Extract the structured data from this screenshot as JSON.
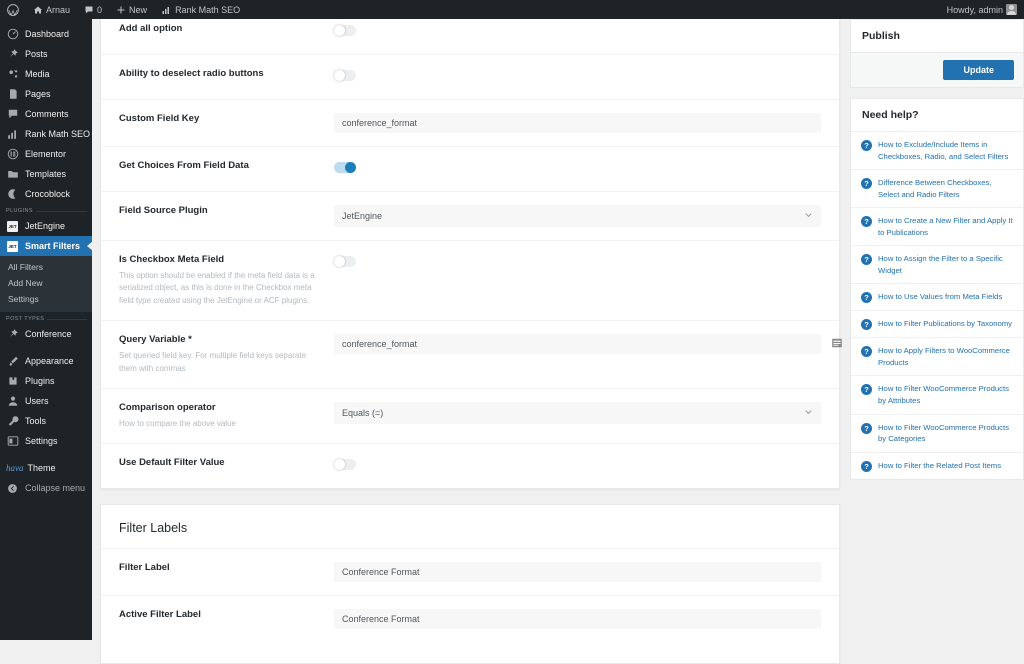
{
  "adminbar": {
    "wp_logo": "wordpress-logo",
    "site_name": "Arnau",
    "comments_count": "0",
    "new_label": "New",
    "rank_math_label": "Rank Math SEO",
    "howdy": "Howdy, admin"
  },
  "sidebar": {
    "items": [
      {
        "label": "Dashboard",
        "icon": "dashboard-icon",
        "name": "dashboard"
      },
      {
        "label": "Posts",
        "icon": "pin-icon",
        "name": "posts"
      },
      {
        "label": "Media",
        "icon": "media-icon",
        "name": "media"
      },
      {
        "label": "Pages",
        "icon": "page-icon",
        "name": "pages"
      },
      {
        "label": "Comments",
        "icon": "comment-icon",
        "name": "comments"
      },
      {
        "label": "Rank Math SEO",
        "icon": "chart-icon",
        "name": "rank-math-seo"
      },
      {
        "label": "Elementor",
        "icon": "elementor-icon",
        "name": "elementor"
      },
      {
        "label": "Templates",
        "icon": "templates-icon",
        "name": "templates"
      },
      {
        "label": "Crocoblock",
        "icon": "crocoblock-icon",
        "name": "crocoblock"
      }
    ],
    "plugins_heading": "PLUGINS",
    "plugin_items": [
      {
        "label": "JetEngine",
        "badge": "JET",
        "name": "jetengine",
        "active": false
      },
      {
        "label": "Smart Filters",
        "badge": "JET",
        "name": "smart-filters",
        "active": true
      }
    ],
    "submenu": [
      {
        "label": "All Filters",
        "name": "all-filters"
      },
      {
        "label": "Add New",
        "name": "add-new"
      },
      {
        "label": "Settings",
        "name": "settings"
      }
    ],
    "posttypes_heading": "POST TYPES",
    "posttype_items": [
      {
        "label": "Conference",
        "icon": "pin-icon",
        "name": "conference"
      }
    ],
    "bottom_items": [
      {
        "label": "Appearance",
        "icon": "brush-icon",
        "name": "appearance"
      },
      {
        "label": "Plugins",
        "icon": "plugins-icon",
        "name": "plugins"
      },
      {
        "label": "Users",
        "icon": "users-icon",
        "name": "users"
      },
      {
        "label": "Tools",
        "icon": "tools-icon",
        "name": "tools"
      },
      {
        "label": "Settings",
        "icon": "settings-icon",
        "name": "settings"
      }
    ],
    "theme_logo": "hava",
    "theme_label": "Theme",
    "collapse_label": "Collapse menu"
  },
  "main": {
    "rows": [
      {
        "label": "Add all option",
        "desc": "",
        "control": "toggle",
        "value": "off",
        "name": "add-all-option"
      },
      {
        "label": "Ability to deselect radio buttons",
        "desc": "",
        "control": "toggle",
        "value": "off",
        "name": "ability-to-deselect-radio-buttons"
      },
      {
        "label": "Custom Field Key",
        "desc": "",
        "control": "text",
        "value": "conference_format",
        "name": "custom-field-key"
      },
      {
        "label": "Get Choices From Field Data",
        "desc": "",
        "control": "toggle",
        "value": "on",
        "name": "get-choices-from-field-data"
      },
      {
        "label": "Field Source Plugin",
        "desc": "",
        "control": "select",
        "value": "JetEngine",
        "name": "field-source-plugin"
      },
      {
        "label": "Is Checkbox Meta Field",
        "desc": "This option should be enabled if the meta field data is a serialized object, as this is done in the Checkbox meta field type created using the JetEngine or ACF plugins.",
        "control": "toggle",
        "value": "off",
        "name": "is-checkbox-meta-field"
      },
      {
        "label": "Query Variable *",
        "desc": "Set queried field key. For multiple field keys separate them with commas",
        "control": "text-macro",
        "value": "conference_format",
        "name": "query-variable"
      },
      {
        "label": "Comparison operator",
        "desc": "How to compare the above value",
        "control": "select",
        "value": "Equals (=)",
        "name": "comparison-operator"
      },
      {
        "label": "Use Default Filter Value",
        "desc": "",
        "control": "toggle",
        "value": "off",
        "name": "use-default-filter-value"
      }
    ]
  },
  "labels_panel": {
    "title": "Filter Labels",
    "rows": [
      {
        "label": "Filter Label",
        "value": "Conference Format",
        "name": "filter-label"
      },
      {
        "label": "Active Filter Label",
        "value": "Conference Format",
        "name": "active-filter-label"
      }
    ]
  },
  "publish": {
    "title": "Publish",
    "update_label": "Update"
  },
  "help": {
    "title": "Need help?",
    "items": [
      "How to Exclude/Include Items in Checkboxes, Radio, and Select Filters",
      "Difference Between Checkboxes, Select and Radio Filters",
      "How to Create a New Filter and Apply It to Publications",
      "How to Assign the Filter to a Specific Widget",
      "How to Use Values from Meta Fields",
      "How to Filter Publications by Taxonomy",
      "How to Apply Filters to WooCommerce Products",
      "How to Filter WooCommerce Products by Attributes",
      "How to Filter WooCommerce Products by Categories",
      "How to Filter the Related Post Items"
    ]
  },
  "colors": {
    "accent": "#2271b1",
    "admin_bg": "#1d2327",
    "toggle_on": "#1e7fb8"
  }
}
